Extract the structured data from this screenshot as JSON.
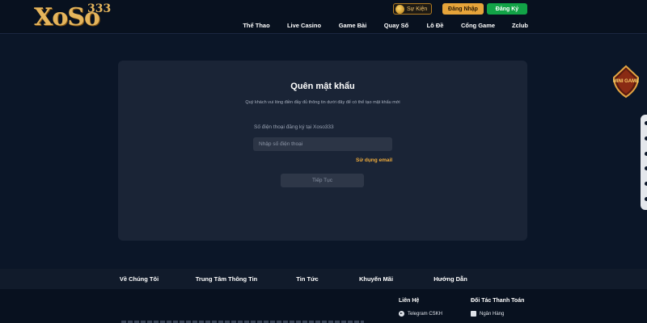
{
  "header": {
    "logo_text": "XoSo",
    "logo_sup": "333",
    "event_label": "Sự Kiện",
    "login_label": "Đăng Nhập",
    "register_label": "Đăng Ký",
    "nav": [
      "Thể Thao",
      "Live Casino",
      "Game Bài",
      "Quay Số",
      "Lô Đề",
      "Cổng Game",
      "Zclub"
    ]
  },
  "form": {
    "title": "Quên mật khẩu",
    "subtitle": "Quý khách vui lòng điền đầy đủ thông tin dưới đây để có thể tạo mật khẩu mới",
    "phone_label": "Số điện thoại đăng ký tại Xoso333",
    "phone_placeholder": "Nhập số điện thoại",
    "phone_value": "",
    "email_link": "Sử dụng email",
    "continue_label": "Tiếp Tục"
  },
  "widgets": {
    "mini_game_label": "MINI GAME"
  },
  "footer": {
    "links": [
      "Về Chúng Tôi",
      "Trung Tâm Thông Tin",
      "Tin Tức",
      "Khuyến Mãi",
      "Hướng Dẫn"
    ],
    "contact_heading": "Liên Hệ",
    "contact_item": "Telegram CSKH",
    "partner_heading": "Đối Tác Thanh Toán",
    "partner_item": "Ngân Hàng"
  },
  "colors": {
    "background": "#0b1628",
    "card": "#1a2436",
    "accent_gold": "#e6a43a",
    "accent_green": "#12a347",
    "link_orange": "#f0ac3c"
  }
}
